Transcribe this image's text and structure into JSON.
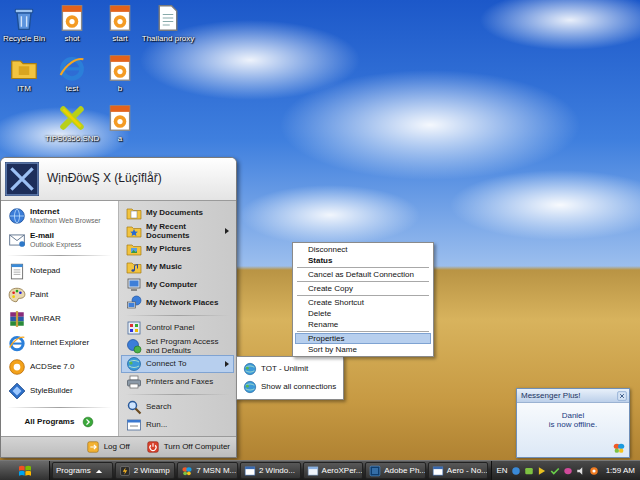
{
  "desktop": {
    "icon_columns": [
      [
        {
          "label": "Recycle Bin"
        },
        {
          "label": "ITM"
        }
      ],
      [
        {
          "label": "shot"
        },
        {
          "label": "test"
        },
        {
          "label": "TIPS0356.SND"
        }
      ],
      [
        {
          "label": "start"
        },
        {
          "label": "b"
        },
        {
          "label": "a"
        }
      ],
      [
        {
          "label": "Thailand proxy"
        }
      ]
    ]
  },
  "start_menu": {
    "user": "WịnĐöwŞ X (Łüçîflåř)",
    "pinned": [
      {
        "title": "Internet",
        "subtitle": "Maxthon Web Browser",
        "selected": false
      },
      {
        "title": "E-mail",
        "subtitle": "Outlook Express",
        "selected": false
      }
    ],
    "recent": [
      {
        "label": "Notepad",
        "selected": false
      },
      {
        "label": "Paint",
        "selected": false
      },
      {
        "label": "WinRAR",
        "selected": false
      },
      {
        "label": "Internet Explorer",
        "selected": false
      },
      {
        "label": "ACDSee 7.0",
        "selected": false
      },
      {
        "label": "StyleBuilder",
        "selected": false
      }
    ],
    "all_programs": "All Programs",
    "places_groups": [
      [
        {
          "label": "My Documents",
          "kind": "folder",
          "submenu": false,
          "selected": false
        },
        {
          "label": "My Recent Documents",
          "kind": "folder",
          "submenu": true,
          "selected": false
        },
        {
          "label": "My Pictures",
          "kind": "folder",
          "submenu": false,
          "selected": false
        },
        {
          "label": "My Music",
          "kind": "folder",
          "submenu": false,
          "selected": false
        },
        {
          "label": "My Computer",
          "kind": "folder",
          "submenu": false,
          "selected": false
        },
        {
          "label": "My Network Places",
          "kind": "folder",
          "submenu": false,
          "selected": false
        }
      ],
      [
        {
          "label": "Control Panel",
          "kind": "tool",
          "submenu": false,
          "selected": false
        },
        {
          "label": "Set Program Access and Defaults",
          "kind": "tool",
          "submenu": false,
          "selected": false
        },
        {
          "label": "Connect To",
          "kind": "tool",
          "submenu": true,
          "selected": true
        },
        {
          "label": "Printers and Faxes",
          "kind": "tool",
          "submenu": false,
          "selected": false
        }
      ],
      [
        {
          "label": "Search",
          "kind": "tool",
          "submenu": false,
          "selected": false
        },
        {
          "label": "Run...",
          "kind": "tool",
          "submenu": false,
          "selected": false
        }
      ]
    ],
    "footer": [
      {
        "label": "Log Off"
      },
      {
        "label": "Turn Off Computer"
      }
    ]
  },
  "connect_submenu": [
    {
      "label": "TOT - Unlimit",
      "selected": false
    },
    {
      "label": "Show all connections",
      "selected": false
    }
  ],
  "context_menu": [
    [
      {
        "label": "Disconnect",
        "default": false,
        "selected": false
      },
      {
        "label": "Status",
        "default": true,
        "selected": false
      }
    ],
    [
      {
        "label": "Cancel as Default Connection",
        "default": false,
        "selected": false
      }
    ],
    [
      {
        "label": "Create Copy",
        "default": false,
        "selected": false
      }
    ],
    [
      {
        "label": "Create Shortcut",
        "default": false,
        "selected": false
      },
      {
        "label": "Delete",
        "default": false,
        "selected": false
      },
      {
        "label": "Rename",
        "default": false,
        "selected": false
      }
    ],
    [
      {
        "label": "Properties",
        "default": false,
        "selected": true
      },
      {
        "label": "Sort by Name",
        "default": false,
        "selected": false
      }
    ]
  ],
  "notification": {
    "title": "Messenger Plus!",
    "lines": [
      "Daniel",
      "is now offline."
    ]
  },
  "taskbar": {
    "buttons": [
      {
        "label": "Programs",
        "selected": false
      },
      {
        "label": "2 Winamp",
        "selected": false
      },
      {
        "label": "7 MSN M...",
        "selected": false
      },
      {
        "label": "2 Windo...",
        "selected": false
      },
      {
        "label": "AeroXPer...",
        "selected": false
      },
      {
        "label": "Adobe Ph...",
        "selected": false
      },
      {
        "label": "Aero - No...",
        "selected": false
      }
    ],
    "language": "EN",
    "clock": "1:59 AM"
  }
}
